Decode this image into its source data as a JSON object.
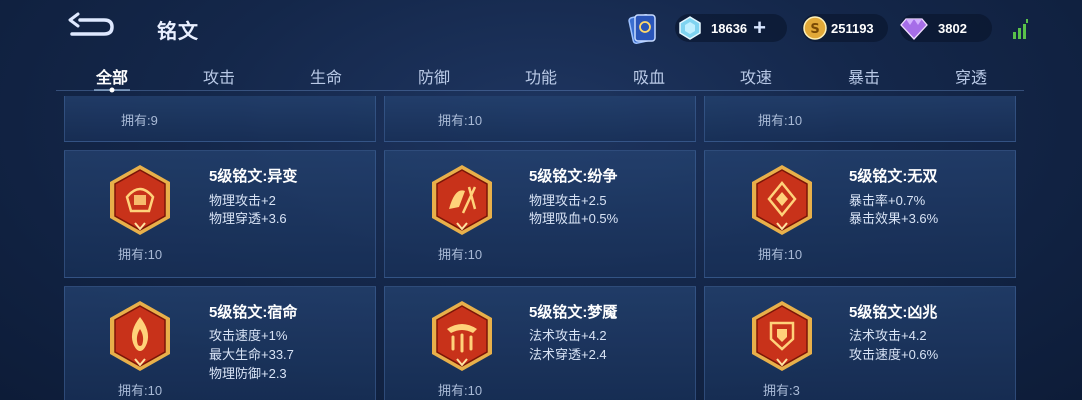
{
  "header": {
    "title": "铭文",
    "currencies": [
      {
        "name": "diamond",
        "value": "18636",
        "icon": "diamond-icon"
      },
      {
        "name": "gold",
        "value": "251193",
        "icon": "gold-coin-icon"
      },
      {
        "name": "gem",
        "value": "3802",
        "icon": "purple-gem-icon"
      }
    ],
    "plus_label": "+"
  },
  "tabs": [
    {
      "label": "全部",
      "active": true
    },
    {
      "label": "攻击"
    },
    {
      "label": "生命"
    },
    {
      "label": "防御"
    },
    {
      "label": "功能"
    },
    {
      "label": "吸血"
    },
    {
      "label": "攻速"
    },
    {
      "label": "暴击"
    },
    {
      "label": "穿透"
    }
  ],
  "top_row": [
    {
      "owned": "拥有:9"
    },
    {
      "owned": "拥有:10"
    },
    {
      "owned": "拥有:10"
    }
  ],
  "runes": [
    {
      "title": "5级铭文:异变",
      "attrs": [
        "物理攻击+2",
        "物理穿透+3.6"
      ],
      "owned": "拥有:10",
      "icon": "rune-yibian-icon"
    },
    {
      "title": "5级铭文:纷争",
      "attrs": [
        "物理攻击+2.5",
        "物理吸血+0.5%"
      ],
      "owned": "拥有:10",
      "icon": "rune-fenzheng-icon"
    },
    {
      "title": "5级铭文:无双",
      "attrs": [
        "暴击率+0.7%",
        "暴击效果+3.6%"
      ],
      "owned": "拥有:10",
      "icon": "rune-wushuang-icon"
    },
    {
      "title": "5级铭文:宿命",
      "attrs": [
        "攻击速度+1%",
        "最大生命+33.7",
        "物理防御+2.3"
      ],
      "owned": "拥有:10",
      "icon": "rune-suming-icon"
    },
    {
      "title": "5级铭文:梦魇",
      "attrs": [
        "法术攻击+4.2",
        "法术穿透+2.4"
      ],
      "owned": "拥有:10",
      "icon": "rune-mengyan-icon"
    },
    {
      "title": "5级铭文:凶兆",
      "attrs": [
        "法术攻击+4.2",
        "攻击速度+0.6%"
      ],
      "owned": "拥有:3",
      "icon": "rune-xiongzhao-icon"
    }
  ],
  "colors": {
    "emblem_red": "#c8321a",
    "emblem_gold": "#e8b04a",
    "bg": "#14274a"
  }
}
